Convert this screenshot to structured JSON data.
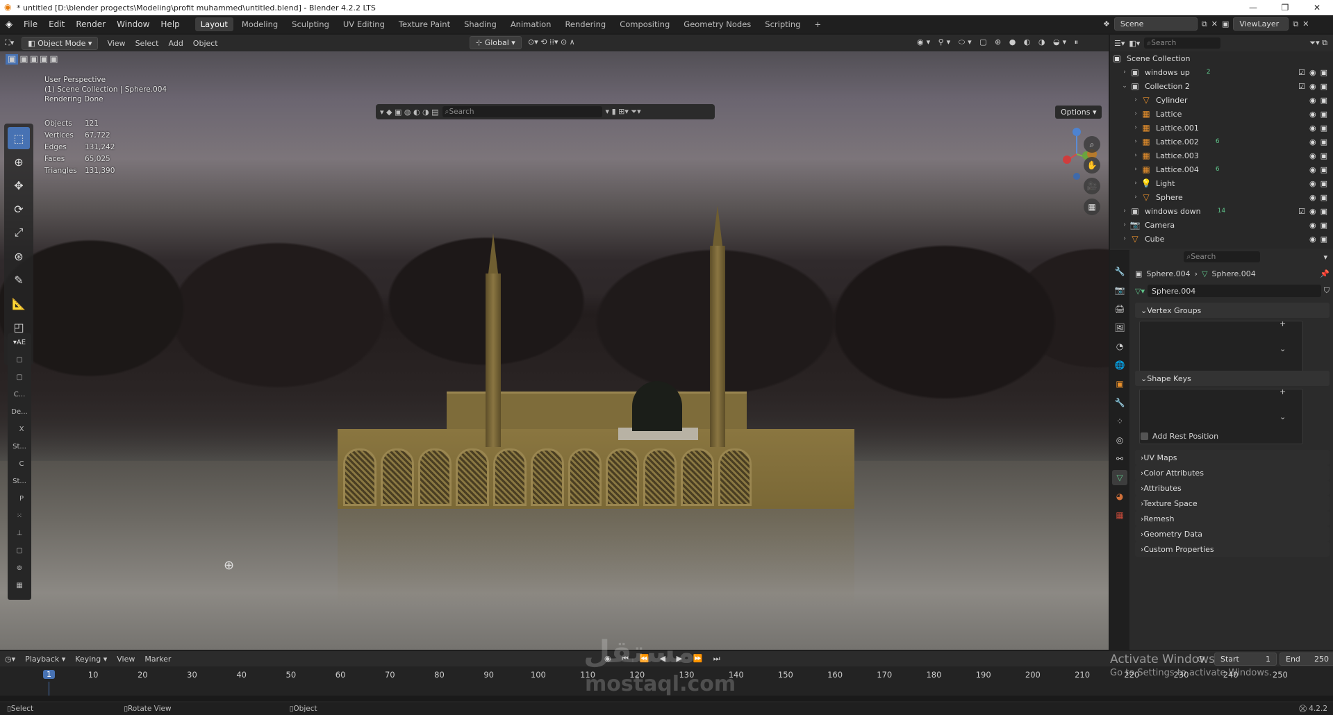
{
  "window": {
    "title": "* untitled [D:\\blender progects\\Modeling\\profit muhammed\\untitled.blend] - Blender 4.2.2 LTS"
  },
  "menu": [
    "File",
    "Edit",
    "Render",
    "Window",
    "Help"
  ],
  "workspaces": [
    "Layout",
    "Modeling",
    "Sculpting",
    "UV Editing",
    "Texture Paint",
    "Shading",
    "Animation",
    "Rendering",
    "Compositing",
    "Geometry Nodes",
    "Scripting"
  ],
  "active_workspace": "Layout",
  "scene": {
    "label": "Scene",
    "view_layer": "ViewLayer"
  },
  "viewport_header": {
    "mode": "Object Mode",
    "menus": [
      "View",
      "Select",
      "Add",
      "Object"
    ],
    "transform": "Global"
  },
  "viewport": {
    "perspective": "User Perspective",
    "collection_info": "(1) Scene Collection | Sphere.004",
    "render_status": "Rendering Done",
    "search_placeholder": "Search",
    "options_label": "Options",
    "stats": [
      {
        "k": "Objects",
        "v": "121"
      },
      {
        "k": "Vertices",
        "v": "67,722"
      },
      {
        "k": "Edges",
        "v": "131,242"
      },
      {
        "k": "Faces",
        "v": "65,025"
      },
      {
        "k": "Triangles",
        "v": "131,390"
      }
    ],
    "side_panel": {
      "tab": "AE",
      "items": [
        "C...",
        "De...",
        "X",
        "St...",
        "C",
        "St...",
        "P"
      ]
    }
  },
  "outliner": {
    "search_placeholder": "Search",
    "root": "Scene Collection",
    "rows": [
      {
        "name": "windows up",
        "level": 1,
        "sub": "2"
      },
      {
        "name": "Collection 2",
        "level": 1,
        "sub": ""
      },
      {
        "name": "Cylinder",
        "level": 2,
        "sub": ""
      },
      {
        "name": "Lattice",
        "level": 2,
        "sub": ""
      },
      {
        "name": "Lattice.001",
        "level": 2,
        "sub": ""
      },
      {
        "name": "Lattice.002",
        "level": 2,
        "sub": "6"
      },
      {
        "name": "Lattice.003",
        "level": 2,
        "sub": ""
      },
      {
        "name": "Lattice.004",
        "level": 2,
        "sub": "6"
      },
      {
        "name": "Light",
        "level": 2,
        "sub": ""
      },
      {
        "name": "Sphere",
        "level": 2,
        "sub": ""
      },
      {
        "name": "windows down",
        "level": 1,
        "sub": "14"
      },
      {
        "name": "Camera",
        "level": 1,
        "sub": ""
      },
      {
        "name": "Cube",
        "level": 1,
        "sub": ""
      }
    ]
  },
  "properties": {
    "search_placeholder": "Search",
    "breadcrumb_obj": "Sphere.004",
    "breadcrumb_data": "Sphere.004",
    "mesh_name": "Sphere.004",
    "sections": {
      "vertex_groups": "Vertex Groups",
      "shape_keys": "Shape Keys",
      "add_rest_position": "Add Rest Position",
      "collapsed": [
        "UV Maps",
        "Color Attributes",
        "Attributes",
        "Texture Space",
        "Remesh",
        "Geometry Data",
        "Custom Properties"
      ]
    }
  },
  "timeline": {
    "menus": [
      "Playback",
      "Keying",
      "View",
      "Marker"
    ],
    "current_frame": "1",
    "start_label": "Start",
    "start": "1",
    "end_label": "End",
    "end": "250",
    "ticks": [
      "10",
      "20",
      "30",
      "40",
      "50",
      "60",
      "70",
      "80",
      "90",
      "100",
      "110",
      "120",
      "130",
      "140",
      "150",
      "160",
      "170",
      "180",
      "190",
      "200",
      "210",
      "220",
      "230",
      "240",
      "250"
    ]
  },
  "activation": {
    "line1": "Activate Windows",
    "line2": "Go to Settings to activate Windows."
  },
  "watermark": {
    "arabic": "مستقل",
    "latin": "mostaql.com"
  },
  "statusbar": {
    "select": "Select",
    "rotate": "Rotate View",
    "object": "Object",
    "version": "4.2.2"
  }
}
